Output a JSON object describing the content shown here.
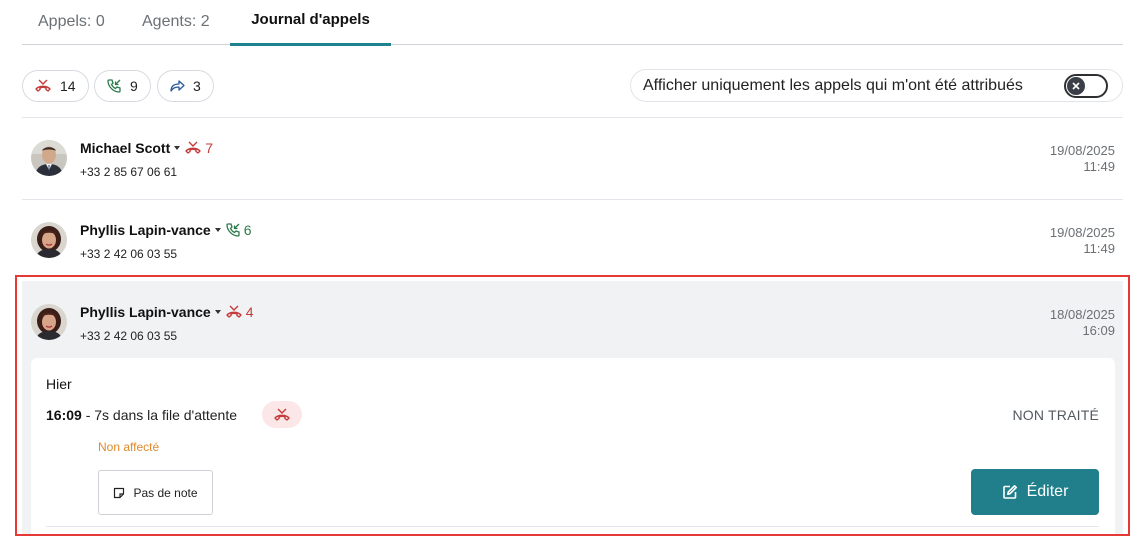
{
  "tabs": [
    {
      "label": "Appels: 0"
    },
    {
      "label": "Agents: 2"
    },
    {
      "label": "Journal d'appels",
      "active": true
    }
  ],
  "filters": {
    "missed_count": "14",
    "answered_count": "9",
    "forwarded_count": "3",
    "only_assigned_label": "Afficher uniquement les appels qui m'ont été attribués",
    "only_assigned_enabled": false
  },
  "calls": [
    {
      "name": "Michael Scott",
      "status_icon": "missed-call-icon",
      "count": "7",
      "phone": "+33 2 85 67 06 61",
      "date": "19/08/2025",
      "time": "11:49"
    },
    {
      "name": "Phyllis Lapin-vance",
      "status_icon": "answered-call-icon",
      "count": "6",
      "phone": "+33 2 42 06 03 55",
      "date": "19/08/2025",
      "time": "11:49"
    },
    {
      "name": "Phyllis Lapin-vance",
      "status_icon": "missed-call-icon",
      "count": "4",
      "phone": "+33 2 42 06 03 55",
      "date": "18/08/2025",
      "time": "16:09",
      "expanded": true
    }
  ],
  "detail": {
    "day": "Hier",
    "time": "16:09",
    "queue_text": "- 7s dans la file d'attente",
    "status": "NON TRAITÉ",
    "assignee": "Non affecté",
    "note_label": "Pas de note",
    "edit_label": "Éditer"
  },
  "colors": {
    "accent": "#217f8c",
    "missed": "#c53a3a",
    "answered": "#2c7a4b",
    "forwarded": "#2a5a9a",
    "warning": "#e08a2c",
    "highlight_border": "#e53935"
  }
}
